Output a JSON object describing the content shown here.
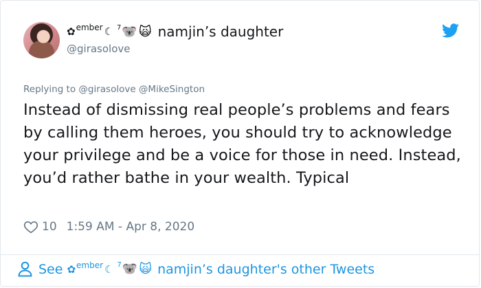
{
  "author": {
    "name_prefix_symbol": "✿",
    "name_prefix_sup": "ember",
    "name_moon": "☾",
    "name_sup7": "7",
    "name_koala": "🐨",
    "name_hamster": "🙀",
    "display_name": "namjin’s daughter",
    "handle": "@girasolove"
  },
  "tweet": {
    "replying_to": "Replying to @girasolove @MikeSington",
    "text": "Instead of dismissing real people’s problems and fears by calling them heroes, you should try to acknowledge your privilege and be a voice for those in need. Instead, you’d rather bathe in your wealth. Typical",
    "likes": "10",
    "timestamp": "1:59 AM - Apr 8, 2020"
  },
  "footer": {
    "see_label": "See",
    "other_tweets_label": "namjin’s daughter's other Tweets"
  },
  "colors": {
    "text": "#14171a",
    "muted": "#657786",
    "link": "#1b95e0",
    "twitter_brand": "#1da1f2"
  },
  "icons": [
    "avatar",
    "twitter-bird-icon",
    "heart-icon",
    "person-icon"
  ]
}
